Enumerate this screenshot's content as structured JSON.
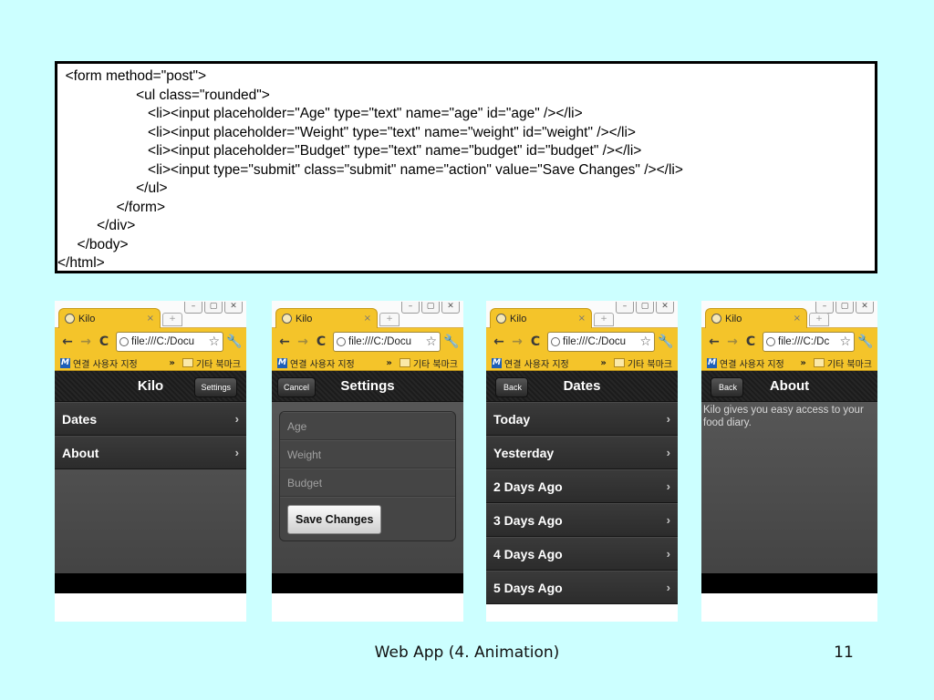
{
  "code_lines": [
    "  <form method=\"post\">",
    "                    <ul class=\"rounded\">",
    "                       <li><input placeholder=\"Age\" type=\"text\" name=\"age\" id=\"age\" /></li>",
    "                       <li><input placeholder=\"Weight\" type=\"text\" name=\"weight\" id=\"weight\" /></li>",
    "                       <li><input placeholder=\"Budget\" type=\"text\" name=\"budget\" id=\"budget\" /></li>",
    "                       <li><input type=\"submit\" class=\"submit\" name=\"action\" value=\"Save Changes\" /></li>",
    "                    </ul>",
    "               </form>",
    "          </div>",
    "     </body>",
    "</html>"
  ],
  "browser": {
    "tab_title": "Kilo",
    "tab_close": "×",
    "new_tab": "+",
    "url_long": "file:///C:/Docu",
    "url_short": "file:///C:/Dc",
    "back_icon": "←",
    "forward_icon": "→",
    "reload_icon": "C",
    "star_icon": "☆",
    "wrench_icon": "🔧",
    "bookmark_m": "M",
    "bookmark_label": "연결 사용자 지정",
    "bookmark_chevron": "»",
    "bookmark_other": "기타 북마크",
    "win_min": "–",
    "win_max": "▢",
    "win_close": "✕"
  },
  "screens": {
    "home": {
      "title": "Kilo",
      "right_button": "Settings",
      "items": [
        "Dates",
        "About"
      ]
    },
    "settings": {
      "title": "Settings",
      "left_button": "Cancel",
      "fields": [
        "Age",
        "Weight",
        "Budget"
      ],
      "submit": "Save Changes"
    },
    "dates": {
      "title": "Dates",
      "back_button": "Back",
      "items": [
        "Today",
        "Yesterday",
        "2 Days Ago",
        "3 Days Ago",
        "4 Days Ago",
        "5 Days Ago"
      ]
    },
    "about": {
      "title": "About",
      "back_button": "Back",
      "text": "Kilo gives you easy access to your food diary."
    }
  },
  "chevron": "›",
  "footer": {
    "title": "Web App (4. Animation)",
    "page": "11"
  }
}
